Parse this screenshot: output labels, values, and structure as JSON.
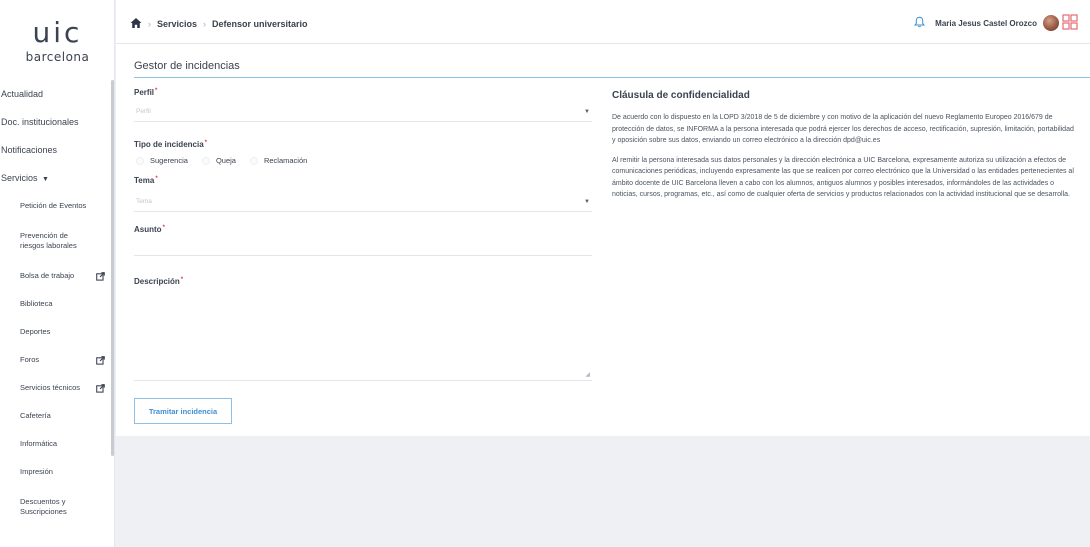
{
  "brand": {
    "logo_main": "uic",
    "logo_sub": "barcelona"
  },
  "colors": {
    "accent": "#3f8fd0",
    "rule": "#8ec0e4",
    "required": "#e0394b",
    "background": "#eef0f3"
  },
  "sidebar": {
    "items": [
      {
        "label": "Actualidad",
        "icon": ""
      },
      {
        "label": "Doc. institucionales",
        "icon": ""
      },
      {
        "label": "Notificaciones",
        "icon": ""
      },
      {
        "label": "Servicios",
        "icon": "caret-down-icon"
      }
    ],
    "sub_items": [
      {
        "label": "Petición de Eventos",
        "external": false
      },
      {
        "label": "Prevención de riesgos laborales",
        "external": false
      },
      {
        "label": "Bolsa de trabajo",
        "external": true
      },
      {
        "label": "Biblioteca",
        "external": false
      },
      {
        "label": "Deportes",
        "external": false
      },
      {
        "label": "Foros",
        "external": true
      },
      {
        "label": "Servicios técnicos",
        "external": true
      },
      {
        "label": "Cafetería",
        "external": false
      },
      {
        "label": "Informática",
        "external": false
      },
      {
        "label": "Impresión",
        "external": false
      },
      {
        "label": "Descuentos y Suscripciones",
        "external": false
      }
    ]
  },
  "header": {
    "breadcrumb": [
      "Servicios",
      "Defensor universitario"
    ],
    "user_name": "Maria Jesus Castel Orozco"
  },
  "main": {
    "title": "Gestor de incidencias",
    "form": {
      "perfil_label": "Perfil",
      "perfil_placeholder": "Perfil",
      "tipo_label": "Tipo de incidencia",
      "tipo_options": [
        "Sugerencia",
        "Queja",
        "Reclamación"
      ],
      "tema_label": "Tema",
      "tema_placeholder": "Tema",
      "asunto_label": "Asunto",
      "asunto_value": "",
      "descripcion_label": "Descripción",
      "descripcion_value": "",
      "submit_label": "Tramitar incidencia"
    },
    "confidentiality": {
      "title": "Cláusula de confidencialidad",
      "paragraph_1": "De acuerdo con lo dispuesto en la LOPD 3/2018 de 5 de diciembre y con motivo de la aplicación del nuevo Reglamento Europeo 2016/679 de protección de datos, se INFORMA a la persona interesada que podrá ejercer los derechos de acceso, rectificación, supresión, limitación, portabilidad y oposición sobre sus datos, enviando un correo electrónico a la dirección dpd@uic.es",
      "paragraph_2": "Al remitir la persona interesada sus datos personales y la dirección electrónica a UIC Barcelona, expresamente autoriza su utilización a efectos de comunicaciones periódicas, incluyendo expresamente las que se realicen por correo electrónico que la Universidad o las entidades pertenecientes al ámbito docente de UIC Barcelona lleven a cabo con los alumnos, antiguos alumnos y posibles interesados, informándoles de las actividades o noticias, cursos, programas, etc., así como de cualquier oferta de servicios y productos relacionados con la actividad institucional que se desarrolla."
    }
  }
}
